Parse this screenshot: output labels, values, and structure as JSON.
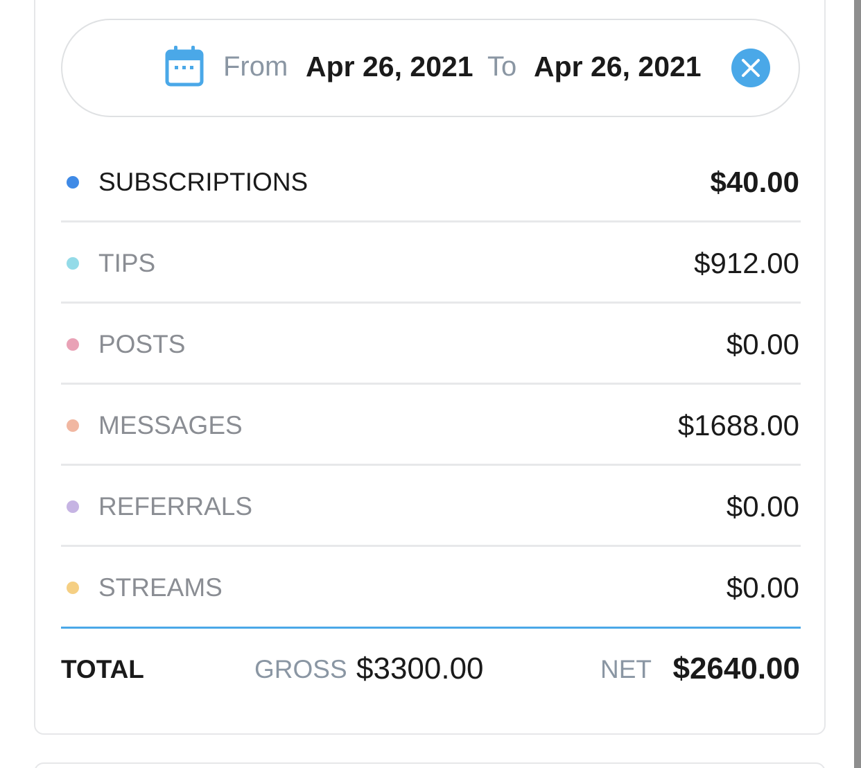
{
  "date_filter": {
    "from_label": "From",
    "from_date": "Apr 26, 2021",
    "to_label": "To",
    "to_date": "Apr 26, 2021",
    "icon": "calendar-icon",
    "clear_icon": "close-icon",
    "accent_color": "#4aa8e8"
  },
  "categories": [
    {
      "label": "SUBSCRIPTIONS",
      "amount": "$40.00",
      "color": "#3f8ae6",
      "active": true
    },
    {
      "label": "TIPS",
      "amount": "$912.00",
      "color": "#94dbe8",
      "active": false
    },
    {
      "label": "POSTS",
      "amount": "$0.00",
      "color": "#e9a2b6",
      "active": false
    },
    {
      "label": "MESSAGES",
      "amount": "$1688.00",
      "color": "#f1b7a1",
      "active": false
    },
    {
      "label": "REFERRALS",
      "amount": "$0.00",
      "color": "#c6b4e3",
      "active": false
    },
    {
      "label": "STREAMS",
      "amount": "$0.00",
      "color": "#f5cf83",
      "active": false
    }
  ],
  "totals": {
    "total_label": "TOTAL",
    "gross_label": "GROSS",
    "gross_value": "$3300.00",
    "net_label": "NET",
    "net_value": "$2640.00",
    "divider_color": "#4aa8e8"
  }
}
